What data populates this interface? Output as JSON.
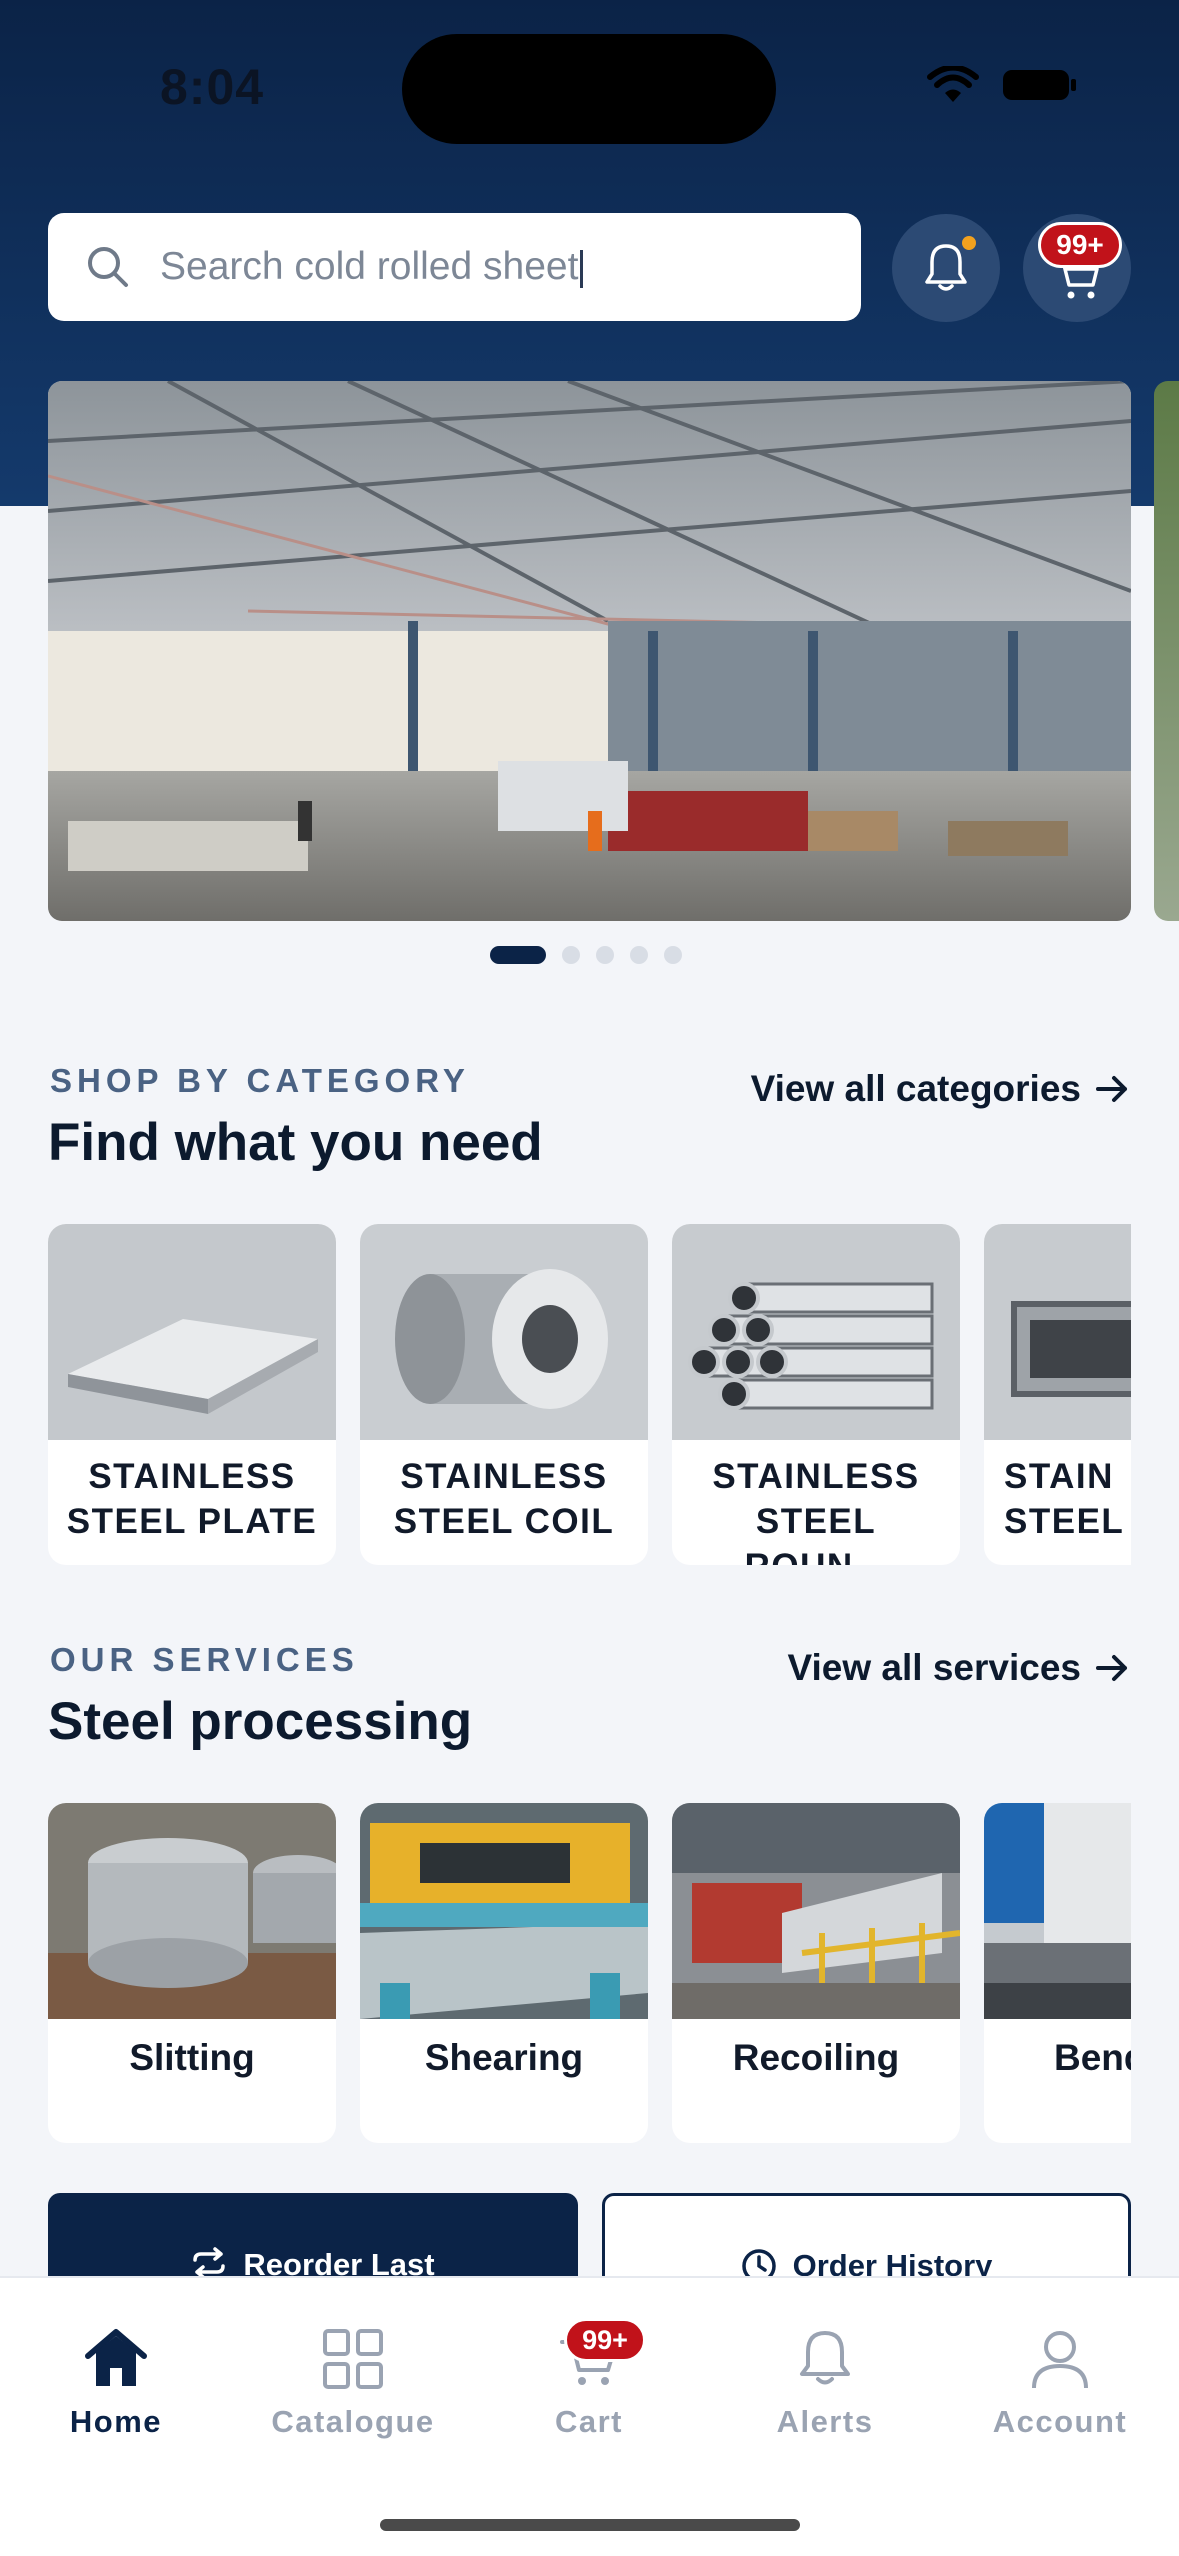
{
  "status_bar": {
    "time": "8:04"
  },
  "search": {
    "placeholder": "Search cold rolled sheet"
  },
  "header": {
    "cart_badge": "99+"
  },
  "banner": {
    "slides_count": 5,
    "active_slide": 1
  },
  "categories": {
    "eyebrow": "SHOP BY CATEGORY",
    "title": "Find what you need",
    "view_all": "View all categories",
    "items": [
      {
        "line1": "STAINLESS",
        "line2": "STEEL PLATE"
      },
      {
        "line1": "STAINLESS",
        "line2": "STEEL COIL"
      },
      {
        "line1": "STAINLESS",
        "line2": "STEEL ROUN..."
      },
      {
        "line1": "STAIN",
        "line2": "STEEL I"
      }
    ]
  },
  "services": {
    "eyebrow": "OUR SERVICES",
    "title": "Steel processing",
    "view_all": "View all services",
    "items": [
      {
        "label": "Slitting"
      },
      {
        "label": "Shearing"
      },
      {
        "label": "Recoiling"
      },
      {
        "label": "Bend"
      }
    ]
  },
  "actions": {
    "reorder": "Reorder Last",
    "history": "Order History"
  },
  "tabbar": {
    "items": [
      {
        "label": "Home",
        "icon": "home-icon",
        "active": true
      },
      {
        "label": "Catalogue",
        "icon": "grid-icon"
      },
      {
        "label": "Cart",
        "icon": "cart-icon"
      },
      {
        "label": "Alerts",
        "icon": "bell-icon"
      },
      {
        "label": "Account",
        "icon": "user-icon"
      }
    ],
    "cart_badge": "99+"
  },
  "colors": {
    "navy": "#0b2347",
    "badge_red": "#c1121a",
    "dot_orange": "#f2a11e",
    "bg": "#f3f5f9"
  }
}
